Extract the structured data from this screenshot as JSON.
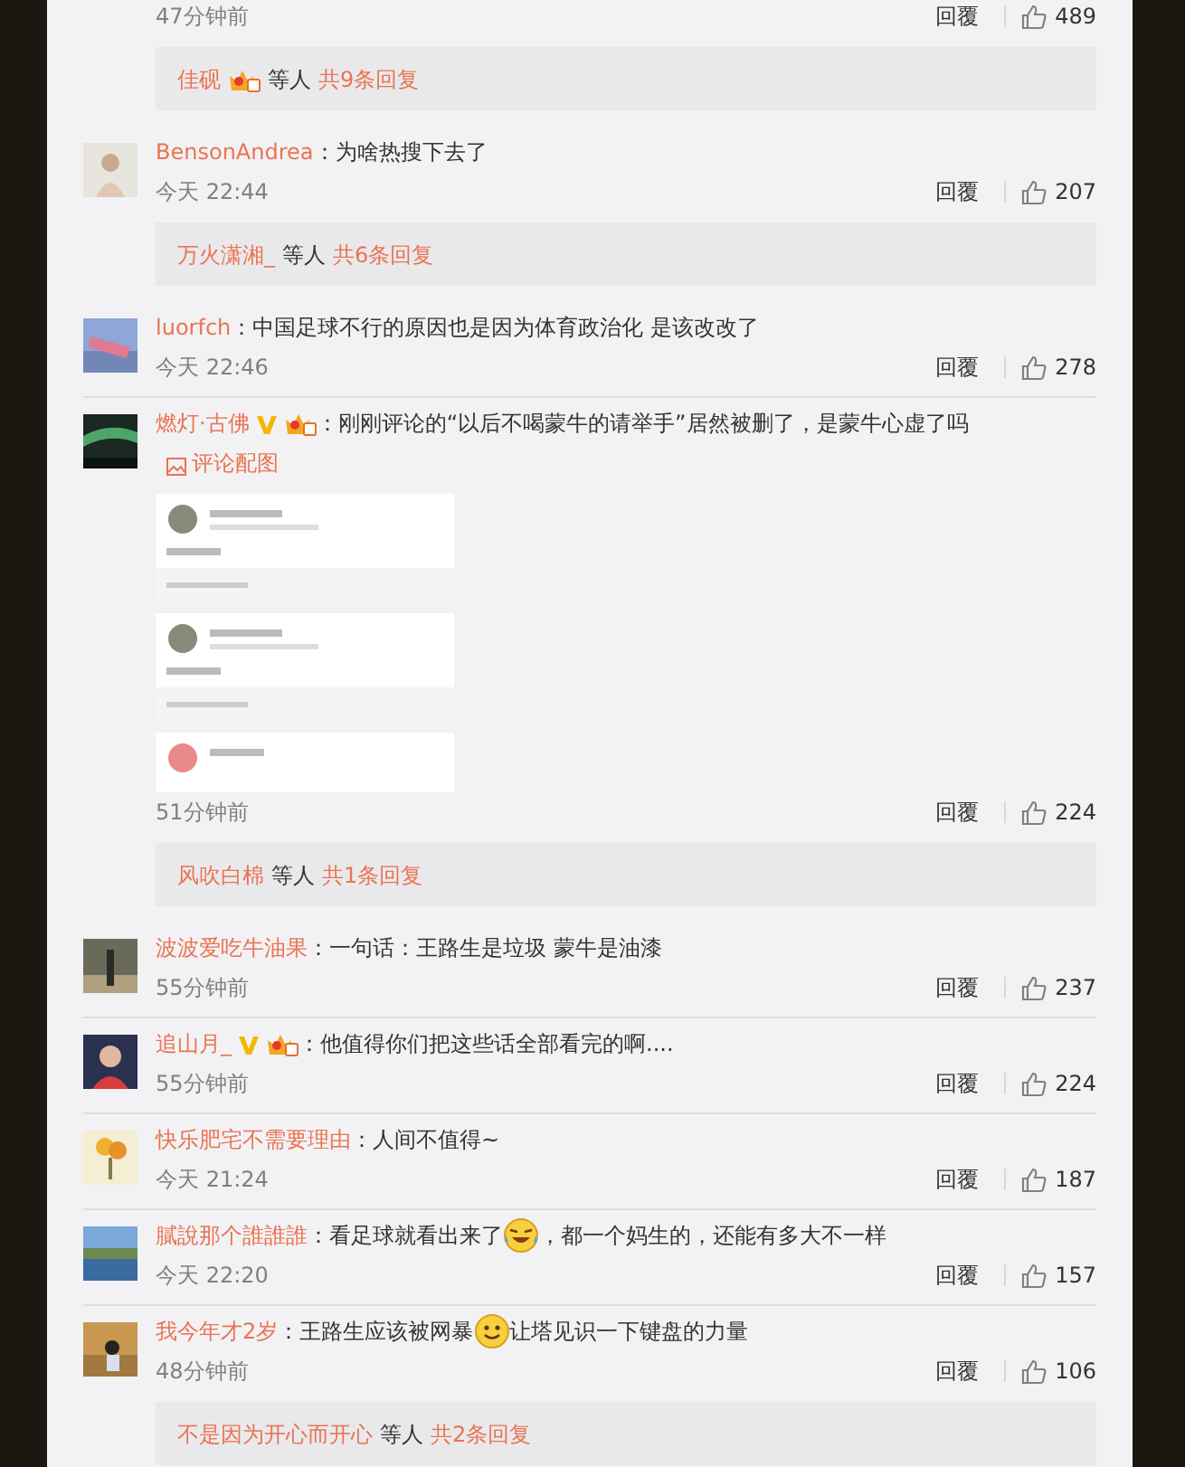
{
  "comments": [
    {
      "time": "47分钟前",
      "reply_label": "回覆",
      "likes": "489",
      "replies": {
        "user": "佳砚",
        "badges": [
          {
            "kind": "crown"
          }
        ],
        "suffix": "等人",
        "count": "共9条回复"
      }
    },
    {
      "user": "BensonAndrea",
      "parts": [
        {
          "kind": "text",
          "text": "：为啥热搜下去了"
        }
      ],
      "time": "今天 22:44",
      "reply_label": "回覆",
      "likes": "207",
      "replies": {
        "user": "万火潇湘_",
        "suffix": "等人",
        "count": "共6条回复"
      }
    },
    {
      "user": "luorfch",
      "parts": [
        {
          "kind": "text",
          "text": "：中国足球不行的原因也是因为体育政治化 是该改改了"
        }
      ],
      "time": "今天 22:46",
      "reply_label": "回覆",
      "likes": "278"
    },
    {
      "user": "燃灯·古佛",
      "badges": [
        {
          "kind": "verified"
        },
        {
          "kind": "crown"
        }
      ],
      "parts": [
        {
          "kind": "text",
          "text": "：刚刚评论的“以后不喝蒙牛的请举手”居然被删了，是蒙牛心虚了吗"
        }
      ],
      "link": "评论配图",
      "image": {
        "kind": "picture"
      },
      "time": "51分钟前",
      "reply_label": "回覆",
      "likes": "224",
      "replies": {
        "user": "风吹白棉",
        "suffix": "等人",
        "count": "共1条回复"
      }
    },
    {
      "user": "波波爱吃牛油果",
      "parts": [
        {
          "kind": "text",
          "text": "：一句话：王路生是垃圾 蒙牛是油漆"
        }
      ],
      "time": "55分钟前",
      "reply_label": "回覆",
      "likes": "237"
    },
    {
      "user": "追山月_",
      "badges": [
        {
          "kind": "verified"
        },
        {
          "kind": "crown"
        }
      ],
      "parts": [
        {
          "kind": "text",
          "text": "：他值得你们把这些话全部看完的啊...."
        }
      ],
      "time": "55分钟前",
      "reply_label": "回覆",
      "likes": "224"
    },
    {
      "user": "快乐肥宅不需要理由",
      "parts": [
        {
          "kind": "text",
          "text": "：人间不值得~"
        }
      ],
      "time": "今天 21:24",
      "reply_label": "回覆",
      "likes": "187"
    },
    {
      "user": "膩說那个誰誰誰",
      "parts": [
        {
          "kind": "text",
          "text": "：看足球就看出来了"
        },
        {
          "kind": "laugh"
        },
        {
          "kind": "text",
          "text": "，都一个妈生的，还能有多大不一样"
        }
      ],
      "time": "今天 22:20",
      "reply_label": "回覆",
      "likes": "157"
    },
    {
      "user": "我今年才2岁",
      "parts": [
        {
          "kind": "text",
          "text": "：王路生应该被网暴"
        },
        {
          "kind": "smile"
        },
        {
          "kind": "text",
          "text": "让塔见识一下键盘的力量"
        }
      ],
      "time": "48分钟前",
      "reply_label": "回覆",
      "likes": "106",
      "replies": {
        "user": "不是因为开心而开心",
        "suffix": "等人",
        "count": "共2条回复"
      }
    }
  ]
}
